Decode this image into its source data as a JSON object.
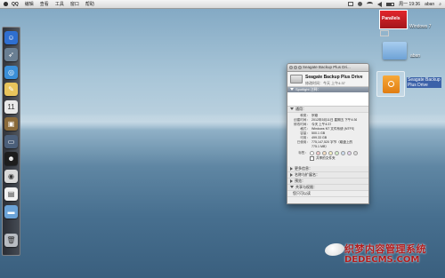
{
  "menubar": {
    "app": "QQ",
    "items": [
      "编辑",
      "查看",
      "工具",
      "窗口",
      "帮助"
    ],
    "right_text": "周一 19:36",
    "user": "aban",
    "status_icons": [
      "box-icon",
      "dot-icon",
      "wifi-icon",
      "speaker-icon",
      "battery-icon"
    ]
  },
  "dock": {
    "items": [
      {
        "name": "finder-icon",
        "color": "#2f6fd0",
        "glyph": "☺"
      },
      {
        "name": "rocket-icon",
        "color": "#6a7f93",
        "glyph": "➶"
      },
      {
        "name": "safari-icon",
        "color": "#3b8fd8",
        "glyph": "◎"
      },
      {
        "name": "notes-icon",
        "color": "#e8c45c",
        "glyph": "✎"
      },
      {
        "name": "calendar-icon",
        "color": "#e9e9e9",
        "glyph": "11"
      },
      {
        "name": "photos-icon",
        "color": "#8a6a3a",
        "glyph": "▣"
      },
      {
        "name": "monitor-icon",
        "color": "#4b5f7a",
        "glyph": "▭"
      },
      {
        "name": "qq-icon",
        "color": "#1d1d1d",
        "glyph": "☻"
      },
      {
        "name": "chrome-icon",
        "color": "#d9d9d9",
        "glyph": "◉"
      },
      {
        "name": "document-icon",
        "color": "#f2f2f2",
        "glyph": "▤"
      },
      {
        "name": "folder-icon",
        "color": "#6ba3d8",
        "glyph": "▬"
      },
      {
        "name": "trash-icon",
        "color": "#b8bcc2",
        "glyph": "🗑"
      }
    ]
  },
  "desktop": {
    "parallels_label": "Windows 7",
    "parallels_badge": "Parallels",
    "folder_label": "aban",
    "drive_label_line1": "Seagate Backup",
    "drive_label_line2": "Plus Drive"
  },
  "window": {
    "title": "Seagate Backup Plus Dri...",
    "header_name": "Seagate Backup Plus Drive",
    "header_sub": "修改时间：今天 上午4:37",
    "spotlight": "Spotlight 注释：",
    "general": "通用：",
    "rows": [
      {
        "k": "种类：",
        "v": "宗卷"
      },
      {
        "k": "创建时间：",
        "v": "2012年5月11日 星期五 下午4:36"
      },
      {
        "k": "修改时间：",
        "v": "今天 上午4:37"
      },
      {
        "k": "格式：",
        "v": "Windows NT 文件系统 (NTFS)"
      },
      {
        "k": "容量：",
        "v": "500.1 GB"
      },
      {
        "k": "可用：",
        "v": "499.33 GB"
      },
      {
        "k": "已使用：",
        "v": "775,147,520 字节（磁盘上的"
      },
      {
        "k": "",
        "v": "775.1 MB）"
      }
    ],
    "label_key": "标签：",
    "shared_folder": "共享的文件夹",
    "sections": [
      "更多信息：",
      "名称与扩展名：",
      "预览：",
      "共享与权限："
    ],
    "footer": "您只可以读"
  },
  "watermark": {
    "line1": "织梦内容管理系统",
    "line2": "DEDECMS.COM"
  }
}
